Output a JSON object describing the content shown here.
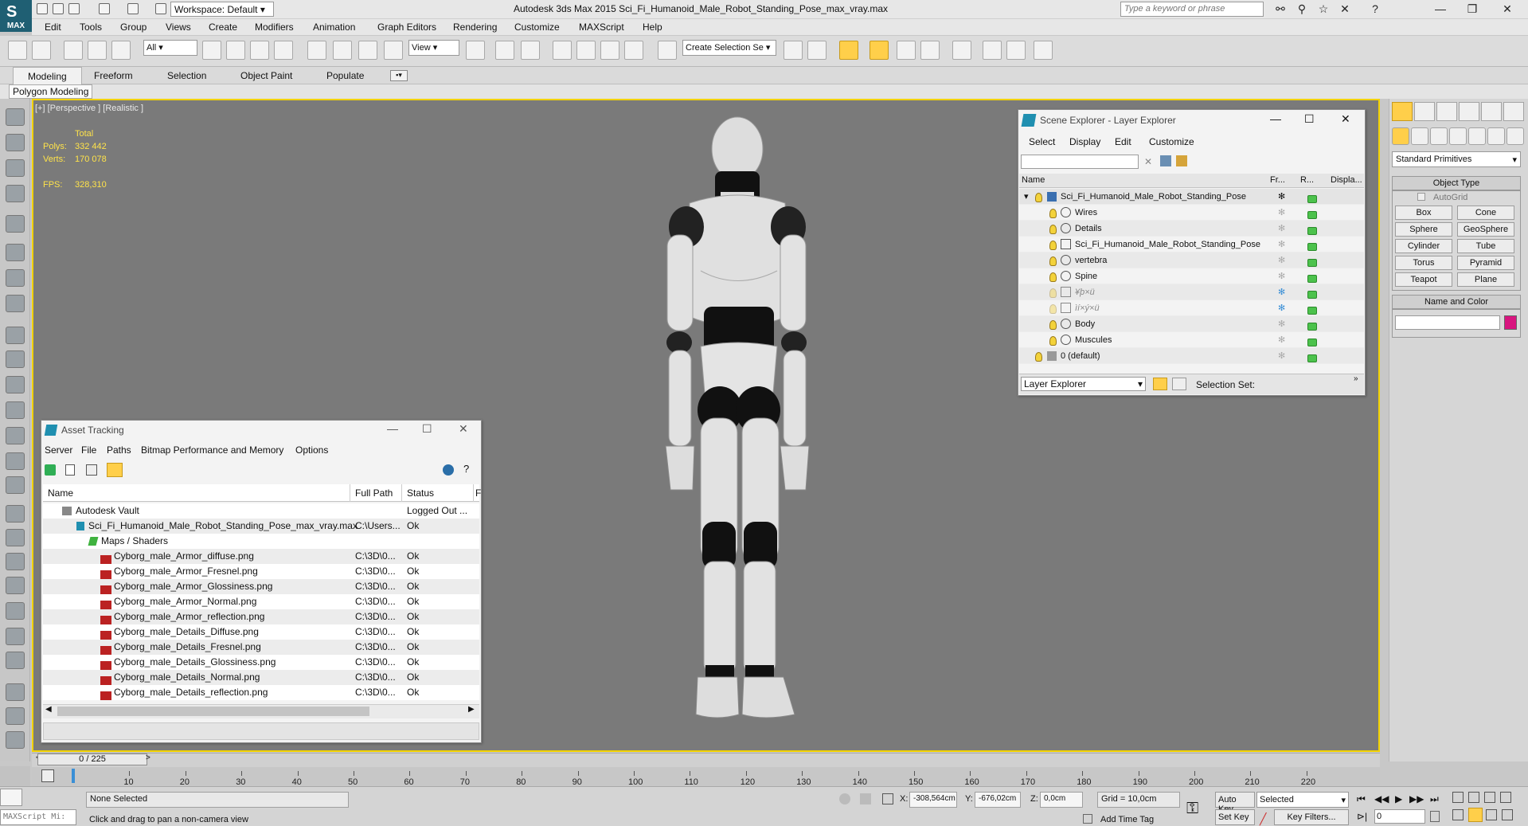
{
  "app": {
    "title": "Autodesk 3ds Max  2015    Sci_Fi_Humanoid_Male_Robot_Standing_Pose_max_vray.max",
    "logo_text": "MAX",
    "workspace": "Workspace: Default",
    "search_placeholder": "Type a keyword or phrase"
  },
  "menu": [
    "Edit",
    "Tools",
    "Group",
    "Views",
    "Create",
    "Modifiers",
    "Animation",
    "Graph Editors",
    "Rendering",
    "Customize",
    "MAXScript",
    "Help"
  ],
  "toolbar": {
    "filter": "All",
    "ref_coord": "View",
    "selection_set": "Create Selection Se"
  },
  "ribbon": {
    "tabs": [
      "Modeling",
      "Freeform",
      "Selection",
      "Object Paint",
      "Populate"
    ],
    "panel": "Polygon Modeling"
  },
  "viewport": {
    "label": "[+] [Perspective ] [Realistic ]",
    "stats": {
      "total_label": "Total",
      "polys_label": "Polys:",
      "polys": "332 442",
      "verts_label": "Verts:",
      "verts": "170 078",
      "fps_label": "FPS:",
      "fps": "328,310"
    }
  },
  "command_panel": {
    "dropdown": "Standard Primitives",
    "object_type_title": "Object Type",
    "autogrid": "AutoGrid",
    "primitives": [
      "Box",
      "Cone",
      "Sphere",
      "GeoSphere",
      "Cylinder",
      "Tube",
      "Torus",
      "Pyramid",
      "Teapot",
      "Plane"
    ],
    "name_color_title": "Name and Color",
    "object_color": "#d8157f"
  },
  "scene_explorer": {
    "title": "Scene Explorer - Layer Explorer",
    "menu": [
      "Select",
      "Display",
      "Edit",
      "Customize"
    ],
    "columns": [
      "Name",
      "Fr...",
      "R...",
      "Displa..."
    ],
    "rows": [
      {
        "name": "Sci_Fi_Humanoid_Male_Robot_Standing_Pose",
        "level": 0
      },
      {
        "name": "Wires",
        "level": 1
      },
      {
        "name": "Details",
        "level": 1
      },
      {
        "name": "Sci_Fi_Humanoid_Male_Robot_Standing_Pose",
        "level": 1
      },
      {
        "name": "vertebra",
        "level": 1
      },
      {
        "name": "Spine",
        "level": 1
      },
      {
        "name": "¥þ×ü",
        "level": 1
      },
      {
        "name": "ìí×ý×ü",
        "level": 1
      },
      {
        "name": "Body",
        "level": 1
      },
      {
        "name": "Muscules",
        "level": 1
      },
      {
        "name": "0 (default)",
        "level": 0
      }
    ],
    "footer_dropdown": "Layer Explorer",
    "selection_set_label": "Selection Set:"
  },
  "asset_tracking": {
    "title": "Asset Tracking",
    "menu": [
      "Server",
      "File",
      "Paths",
      "Bitmap Performance and Memory",
      "Options"
    ],
    "columns": [
      "Name",
      "Full Path",
      "Status",
      "F"
    ],
    "rows": [
      {
        "name": "Autodesk Vault",
        "path": "",
        "status": "Logged Out ..."
      },
      {
        "name": "Sci_Fi_Humanoid_Male_Robot_Standing_Pose_max_vray.max",
        "path": "C:\\Users...",
        "status": "Ok"
      },
      {
        "name": "Maps / Shaders",
        "path": "",
        "status": ""
      },
      {
        "name": "Cyborg_male_Armor_diffuse.png",
        "path": "C:\\3D\\0...",
        "status": "Ok"
      },
      {
        "name": "Cyborg_male_Armor_Fresnel.png",
        "path": "C:\\3D\\0...",
        "status": "Ok"
      },
      {
        "name": "Cyborg_male_Armor_Glossiness.png",
        "path": "C:\\3D\\0...",
        "status": "Ok"
      },
      {
        "name": "Cyborg_male_Armor_Normal.png",
        "path": "C:\\3D\\0...",
        "status": "Ok"
      },
      {
        "name": "Cyborg_male_Armor_reflection.png",
        "path": "C:\\3D\\0...",
        "status": "Ok"
      },
      {
        "name": "Cyborg_male_Details_Diffuse.png",
        "path": "C:\\3D\\0...",
        "status": "Ok"
      },
      {
        "name": "Cyborg_male_Details_Fresnel.png",
        "path": "C:\\3D\\0...",
        "status": "Ok"
      },
      {
        "name": "Cyborg_male_Details_Glossiness.png",
        "path": "C:\\3D\\0...",
        "status": "Ok"
      },
      {
        "name": "Cyborg_male_Details_Normal.png",
        "path": "C:\\3D\\0...",
        "status": "Ok"
      },
      {
        "name": "Cyborg_male_Details_reflection.png",
        "path": "C:\\3D\\0...",
        "status": "Ok"
      }
    ]
  },
  "timeline": {
    "frame_display": "0 / 225",
    "ticks": [
      "10",
      "20",
      "30",
      "40",
      "50",
      "60",
      "70",
      "80",
      "90",
      "100",
      "110",
      "120",
      "130",
      "140",
      "150",
      "160",
      "170",
      "180",
      "190",
      "200",
      "210",
      "220"
    ]
  },
  "status": {
    "maxscript": "MAXScript Mi:",
    "selection": "None Selected",
    "prompt": "Click and drag to pan a non-camera view",
    "x_label": "X:",
    "x": "-308,564cm",
    "y_label": "Y:",
    "y": "-676,02cm",
    "z_label": "Z:",
    "z": "0,0cm",
    "grid": "Grid = 10,0cm",
    "add_time_tag": "Add Time Tag",
    "auto_key": "Auto Key",
    "set_key": "Set Key",
    "key_mode": "Selected",
    "key_filters": "Key Filters...",
    "frame": "0"
  }
}
